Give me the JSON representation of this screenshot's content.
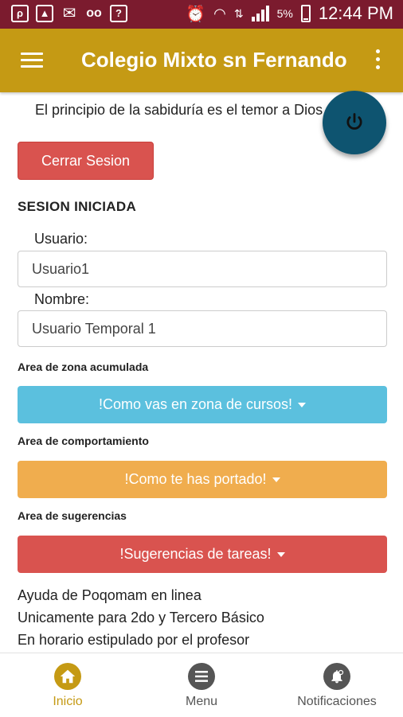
{
  "status_bar": {
    "battery": "5%",
    "time": "12:44 PM"
  },
  "app_bar": {
    "title": "Colegio Mixto sn Fernando"
  },
  "motto": "El principio de la sabiduría es el temor a Dios",
  "logout_button": "Cerrar Sesion",
  "session_heading": "SESION INICIADA",
  "user_field": {
    "label": "Usuario:",
    "value": "Usuario1"
  },
  "name_field": {
    "label": "Nombre:",
    "value": "Usuario Temporal 1"
  },
  "sections": [
    {
      "label": "Area de zona acumulada",
      "button": "!Como vas en zona de cursos!",
      "color": "#5bc0de"
    },
    {
      "label": "Area de comportamiento",
      "button": "!Como te has portado!",
      "color": "#f0ad4e"
    },
    {
      "label": "Area de sugerencias",
      "button": "!Sugerencias de tareas!",
      "color": "#d9534f"
    }
  ],
  "info_lines": [
    "Ayuda  de Poqomam en linea",
    "Unicamente para 2do y Tercero Básico",
    "En horario estipulado por el profesor"
  ],
  "bottom_nav": {
    "home": "Inicio",
    "menu": "Menu",
    "notifications": "Notificaciones"
  },
  "colors": {
    "status_bar": "#7b1b2e",
    "app_bar": "#c59a14",
    "fab": "#0e5470",
    "active_nav": "#c59a14",
    "inactive_nav": "#555555"
  },
  "icons": {
    "fab": "power-icon",
    "home": "home-icon",
    "menu": "menu-icon",
    "notifications": "notifications-icon"
  }
}
